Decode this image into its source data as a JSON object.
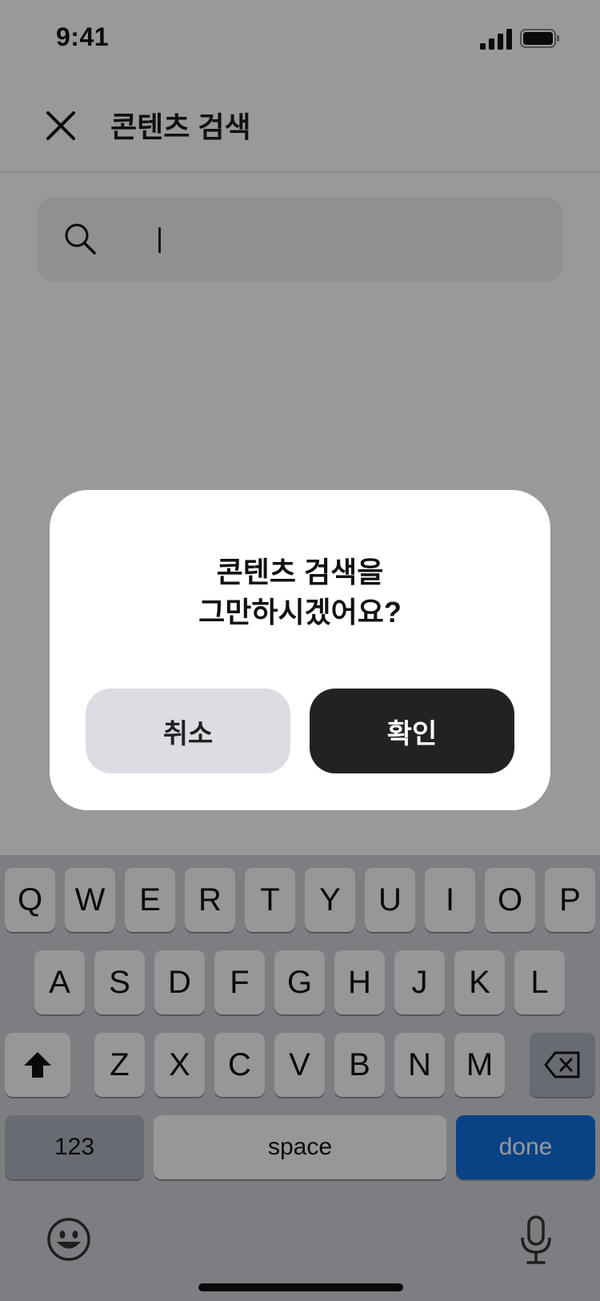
{
  "status_bar": {
    "time": "9:41"
  },
  "header": {
    "title": "콘텐츠 검색",
    "close_icon": "close-icon"
  },
  "search": {
    "value": "",
    "icon": "search-icon"
  },
  "dialog": {
    "message_line1": "콘텐츠 검색을",
    "message_line2": "그만하시겠어요?",
    "cancel_label": "취소",
    "confirm_label": "확인"
  },
  "keyboard": {
    "row1": [
      "Q",
      "W",
      "E",
      "R",
      "T",
      "Y",
      "U",
      "I",
      "O",
      "P"
    ],
    "row2": [
      "A",
      "S",
      "D",
      "F",
      "G",
      "H",
      "J",
      "K",
      "L"
    ],
    "row3": [
      "Z",
      "X",
      "C",
      "V",
      "B",
      "N",
      "M"
    ],
    "numbers_label": "123",
    "space_label": "space",
    "done_label": "done",
    "icons": [
      "shift-icon",
      "backspace-icon",
      "emoji-icon",
      "microphone-icon"
    ]
  },
  "colors": {
    "confirm_button": "#222222",
    "cancel_button": "#dcdce2",
    "done_key": "#1070e0",
    "overlay": "rgba(0,0,0,0.4)"
  }
}
